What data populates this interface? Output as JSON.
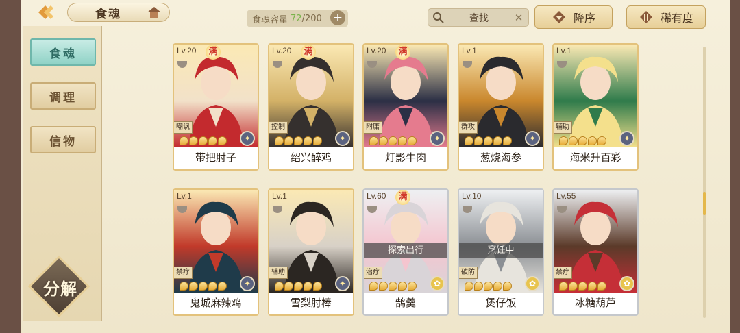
{
  "header": {
    "tab_title": "食魂",
    "capacity_label": "食魂容量",
    "capacity_current": "72",
    "capacity_max": "/200",
    "search_label": "查找",
    "sort_order_label": "降序",
    "sort_rarity_label": "稀有度"
  },
  "sidebar": {
    "tabs": [
      {
        "label": "食魂",
        "active": true
      },
      {
        "label": "调理",
        "active": false
      },
      {
        "label": "信物",
        "active": false
      }
    ],
    "decompose_label": "分解"
  },
  "cards": [
    {
      "level": "Lv.20",
      "full": "满",
      "role": "嘲讽",
      "name": "带把肘子",
      "stars": 5,
      "frame": "gold",
      "colors": [
        "#c32a2e",
        "#f2e1c9"
      ],
      "elem": "night"
    },
    {
      "level": "Lv.20",
      "full": "满",
      "role": "控制",
      "name": "绍兴醉鸡",
      "stars": 5,
      "frame": "gold",
      "colors": [
        "#35302e",
        "#d3b167"
      ],
      "elem": "night"
    },
    {
      "level": "Lv.20",
      "full": "满",
      "role": "附庸",
      "name": "灯影牛肉",
      "stars": 5,
      "frame": "gold",
      "colors": [
        "#e57b8e",
        "#2b2f45"
      ],
      "elem": "night"
    },
    {
      "level": "Lv.1",
      "full": "",
      "role": "群攻",
      "name": "葱烧海参",
      "stars": 5,
      "frame": "gold",
      "colors": [
        "#2a2a2e",
        "#c9872d"
      ],
      "elem": "night"
    },
    {
      "level": "Lv.1",
      "full": "",
      "role": "辅助",
      "name": "海米升百彩",
      "stars": 5,
      "frame": "gold",
      "colors": [
        "#f4e08c",
        "#2f7b4b"
      ],
      "elem": "night"
    },
    {
      "level": "Lv.1",
      "full": "",
      "role": "禁疗",
      "name": "鬼城麻辣鸡",
      "stars": 5,
      "frame": "gold",
      "colors": [
        "#1f3b4a",
        "#c13a2a"
      ],
      "elem": "night"
    },
    {
      "level": "Lv.1",
      "full": "",
      "role": "辅助",
      "name": "雪梨肘棒",
      "stars": 5,
      "frame": "gold",
      "colors": [
        "#2b2622",
        "#d8d1c7"
      ],
      "elem": "night"
    },
    {
      "level": "Lv.60",
      "full": "满",
      "role": "治疗",
      "name": "鹄羹",
      "stars": 5,
      "frame": "gray",
      "colors": [
        "#d9d4d8",
        "#f4c5cf"
      ],
      "elem": "day",
      "status": "探索出行"
    },
    {
      "level": "Lv.10",
      "full": "",
      "role": "破防",
      "name": "煲仔饭",
      "stars": 5,
      "frame": "gray",
      "colors": [
        "#e7e4dd",
        "#8b8f94"
      ],
      "elem": "day",
      "status": "烹饪中"
    },
    {
      "level": "Lv.55",
      "full": "",
      "role": "禁疗",
      "name": "冰糖葫芦",
      "stars": 5,
      "frame": "gray",
      "colors": [
        "#c52f37",
        "#5b3a29"
      ],
      "elem": "day"
    }
  ],
  "icons": {
    "back": "back-arrow-icon",
    "home": "home-icon",
    "search": "search-icon",
    "clear": "clear-icon",
    "sort": "sort-arrow-icon",
    "rarity": "rarity-icon"
  },
  "colors": {
    "accent": "#e4b84b",
    "active_tab": "#8fd2c6",
    "frame_gold": "#e3c27c",
    "frame_gray": "#c5c8cc"
  }
}
